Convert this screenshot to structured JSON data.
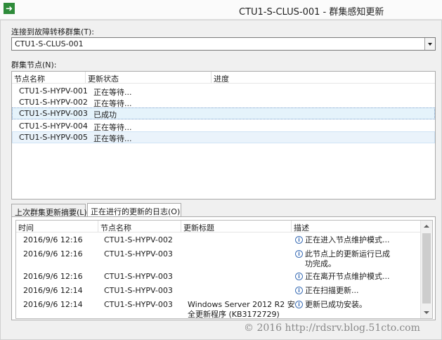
{
  "window": {
    "title": "CTU1-S-CLUS-001 - 群集感知更新",
    "icon": "arrow-right-icon"
  },
  "connect": {
    "label": "连接到故障转移群集(T):",
    "value": "CTU1-S-CLUS-001"
  },
  "nodes": {
    "label": "群集节点(N):",
    "columns": [
      "节点名称",
      "更新状态",
      "进度"
    ],
    "rows": [
      {
        "name": "CTU1-S-HYPV-001",
        "status": "正在等待..."
      },
      {
        "name": "CTU1-S-HYPV-002",
        "status": "正在等待..."
      },
      {
        "name": "CTU1-S-HYPV-003",
        "status": "已成功"
      },
      {
        "name": "CTU1-S-HYPV-004",
        "status": "正在等待..."
      },
      {
        "name": "CTU1-S-HYPV-005",
        "status": "正在等待..."
      }
    ]
  },
  "tabs": [
    "上次群集更新摘要(L)",
    "正在进行的更新的日志(O)"
  ],
  "log": {
    "columns": [
      "时间",
      "节点名称",
      "更新标题",
      "描述"
    ],
    "rows": [
      {
        "time": "2016/9/6 12:16",
        "node": "CTU1-S-HYPV-002",
        "title_l1": "",
        "title_l2": "",
        "desc": "正在进入节点维护模式..."
      },
      {
        "time": "2016/9/6 12:16",
        "node": "CTU1-S-HYPV-003",
        "title_l1": "",
        "title_l2": "",
        "desc": "此节点上的更新运行已成功完成。"
      },
      {
        "time": "2016/9/6 12:16",
        "node": "CTU1-S-HYPV-003",
        "title_l1": "",
        "title_l2": "",
        "desc": "正在离开节点维护模式..."
      },
      {
        "time": "2016/9/6 12:14",
        "node": "CTU1-S-HYPV-003",
        "title_l1": "",
        "title_l2": "",
        "desc": "正在扫描更新..."
      },
      {
        "time": "2016/9/6 12:14",
        "node": "CTU1-S-HYPV-003",
        "title_l1": "Windows Server 2012 R2 安",
        "title_l2": "全更新程序 (KB3172729)",
        "desc": "更新已成功安装。"
      }
    ]
  },
  "watermark": "© 2016 http://rdsrv.blog.51cto.com"
}
